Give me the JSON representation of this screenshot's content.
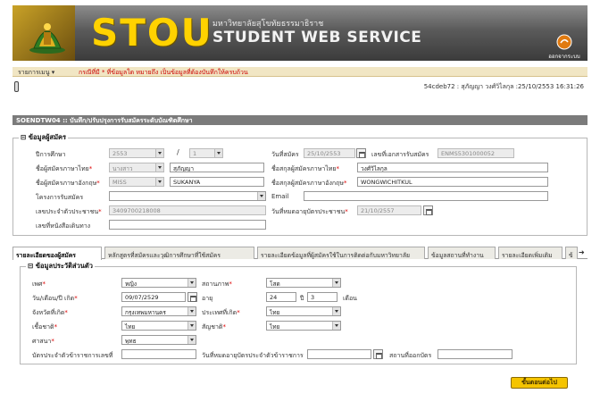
{
  "header": {
    "logo_text": "STOU",
    "university_name": "มหาวิทยาลัยสุโขทัยธรรมาธิราช",
    "service_title": "STUDENT WEB SERVICE",
    "logout_label": "ออกจากระบบ",
    "colors": {
      "stou": "#ffd200",
      "banner": "#5a5a5a"
    }
  },
  "menu": {
    "label": "รายการเมนู ▾",
    "notice": "กรณีที่มี * ที่ข้อมูลใด หมายถึง เป็นข้อมูลที่ต้องบันทึกให้ครบถ้วน"
  },
  "user_info": "54cdeb72 : สุภัญญา วงศ์วิไลกุล :25/10/2553 16:31:26",
  "page_title": "SOENDTW04 :: บันทึก/ปรับปรุงการรับสมัครระดับบัณฑิตศึกษา",
  "applicant": {
    "legend": "ข้อมูลผู้สมัคร",
    "academic_year_label": "ปีการศึกษา",
    "academic_year": "2553",
    "semester": "1",
    "apply_date_label": "วันที่สมัคร",
    "apply_date": "25/10/2553",
    "doc_no_label": "เลขที่เอกสารรับสมัคร",
    "doc_no": "ENMS5301000052",
    "name_th_label": "ชื่อผู้สมัครภาษาไทย",
    "title_th": "นางสาว",
    "first_name_th": "สุภัญญา",
    "surname_th_label": "ชื่อสกุลผู้สมัครภาษาไทย",
    "surname_th": "วงศ์วิไลกุล",
    "name_en_label": "ชื่อผู้สมัครภาษาอังกฤษ",
    "title_en": "MISS",
    "first_name_en": "SUKANYA",
    "surname_en_label": "ชื่อสกุลผู้สมัครภาษาอังกฤษ",
    "surname_en": "WONGWICHITKUL",
    "project_label": "โครงการรับสมัคร",
    "project": "",
    "email_label": "Email",
    "email": "",
    "citizen_id_label": "เลขประจำตัวประชาชน",
    "citizen_id": "3409700218008",
    "id_expiry_label": "วันที่หมดอายุบัตรประชาชน",
    "id_expiry": "21/10/2557",
    "receipt_label": "เลขที่หนังสือเดินทาง",
    "receipt": ""
  },
  "tabs": [
    {
      "label": "รายละเอียดของผู้สมัคร",
      "active": true
    },
    {
      "label": "หลักสูตรที่สมัครและวุฒิการศึกษาที่ใช้สมัคร",
      "active": false
    },
    {
      "label": "รายละเอียดข้อมูลที่ผู้สมัครใช้ในการติดต่อกับมหาวิทยาลัย",
      "active": false
    },
    {
      "label": "ข้อมูลสถานที่ทำงาน",
      "active": false
    },
    {
      "label": "รายละเอียดเพิ่มเติม",
      "active": false
    },
    {
      "label": "ข้",
      "active": false
    }
  ],
  "personal": {
    "legend": "ข้อมูลประวัติส่วนตัว",
    "gender_label": "เพศ",
    "gender": "หญิง",
    "marital_label": "สถานภาพ",
    "marital": "โสด",
    "dob_label": "วัน/เดือน/ปี เกิด",
    "dob": "09/07/2529",
    "age_label": "อายุ",
    "age_years": "24",
    "age_years_unit": "ปี",
    "age_months": "3",
    "age_months_unit": "เดือน",
    "birth_province_label": "จังหวัดที่เกิด",
    "birth_province": "กรุงเทพมหานคร",
    "birth_country_label": "ประเทศที่เกิด",
    "birth_country": "ไทย",
    "ethnicity_label": "เชื้อชาติ",
    "ethnicity": "ไทย",
    "nationality_label": "สัญชาติ",
    "nationality": "ไทย",
    "religion_label": "ศาสนา",
    "religion": "พุทธ",
    "gov_card_label": "บัตรประจำตัวข้าราชการเลขที่",
    "gov_card": "",
    "gov_expiry_label": "วันที่หมดอายุบัตรประจำตัวข้าราชการ",
    "gov_expiry": "",
    "issued_at_label": "สถานที่ออกบัตร",
    "issued_at": ""
  },
  "next_button": "ขั้นตอนต่อไป"
}
